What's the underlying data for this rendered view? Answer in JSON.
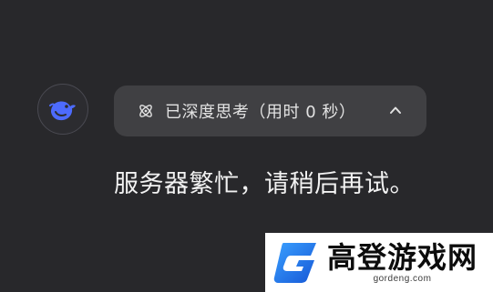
{
  "colors": {
    "background": "#28282b",
    "pill_background": "#404043",
    "avatar_accent": "#4d6bfe",
    "reply_text": "#f2f2f2",
    "pill_text": "#e2e2e2",
    "watermark_blue": "#1e73e8"
  },
  "assistant": {
    "avatar_icon": "whale-logo-icon"
  },
  "thinking": {
    "icon": "atom-icon",
    "label": "已深度思考（用时 0 秒）",
    "toggle_icon": "chevron-up-icon"
  },
  "message": {
    "text": "服务器繁忙，请稍后再试。"
  },
  "watermark": {
    "title": "高登游戏网",
    "domain": "gordeng.com",
    "logo_icon": "g-logo-icon"
  }
}
